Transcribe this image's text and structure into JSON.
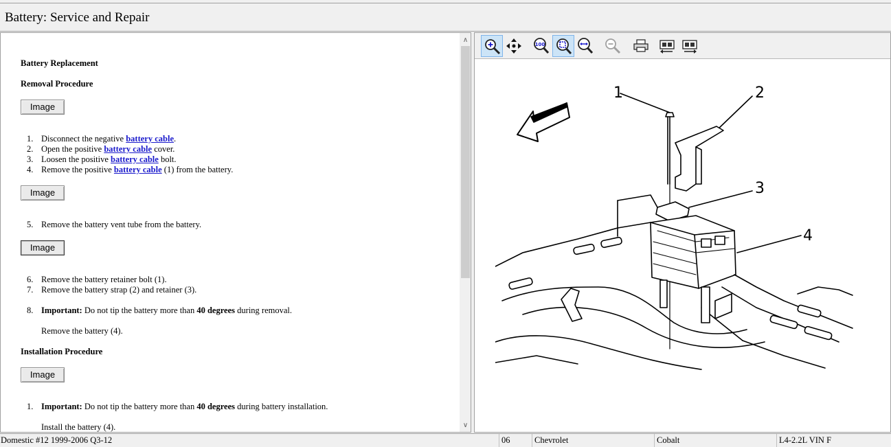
{
  "window": {
    "title": "Battery:  Service and Repair"
  },
  "document": {
    "heading_main": "Battery Replacement",
    "heading_removal": "Removal Procedure",
    "heading_install": "Installation Procedure",
    "image_button_label": "Image",
    "removal_steps_a": [
      {
        "num": "1.",
        "pre": "Disconnect the negative ",
        "link": "battery cable",
        "post": "."
      },
      {
        "num": "2.",
        "pre": "Open the positive ",
        "link": "battery cable",
        "post": " cover."
      },
      {
        "num": "3.",
        "pre": "Loosen the positive ",
        "link": "battery cable",
        "post": " bolt."
      },
      {
        "num": "4.",
        "pre": "Remove the positive ",
        "link": "battery cable",
        "post": " (1) from the battery."
      }
    ],
    "step5": {
      "num": "5.",
      "text": "Remove the battery vent tube from the battery."
    },
    "step6": {
      "num": "6.",
      "text": "Remove the battery retainer bolt (1)."
    },
    "step7": {
      "num": "7.",
      "text": "Remove the battery strap (2) and retainer (3)."
    },
    "step8": {
      "num": "8.",
      "important": "Important:",
      "pre": " Do not tip the battery more than ",
      "bold": "40 degrees",
      "post": " during removal."
    },
    "step8_sub": "Remove the battery (4).",
    "install1": {
      "num": "1.",
      "important": "Important:",
      "pre": " Do not tip the battery more than ",
      "bold": "40 degrees",
      "post": " during battery installation."
    },
    "install1_sub": "Install the battery (4)."
  },
  "diagram": {
    "callouts": [
      "1",
      "2",
      "3",
      "4"
    ]
  },
  "toolbar": {
    "tools": [
      "zoom-in-icon",
      "pan-icon",
      "zoom-100-icon",
      "zoom-fit-icon",
      "zoom-width-icon",
      "zoom-out-icon",
      "print-icon",
      "prev-image-icon",
      "next-image-icon"
    ],
    "active": [
      "zoom-in-icon",
      "zoom-fit-icon"
    ]
  },
  "status": {
    "database": "Domestic #12 1999-2006 Q3-12",
    "year": "06",
    "make": "Chevrolet",
    "model": "Cobalt",
    "engine": "L4-2.2L VIN F"
  },
  "colors": {
    "link": "#1a1acc",
    "active_tool_bg": "#cce4f7",
    "chrome": "#f0f0f0"
  }
}
